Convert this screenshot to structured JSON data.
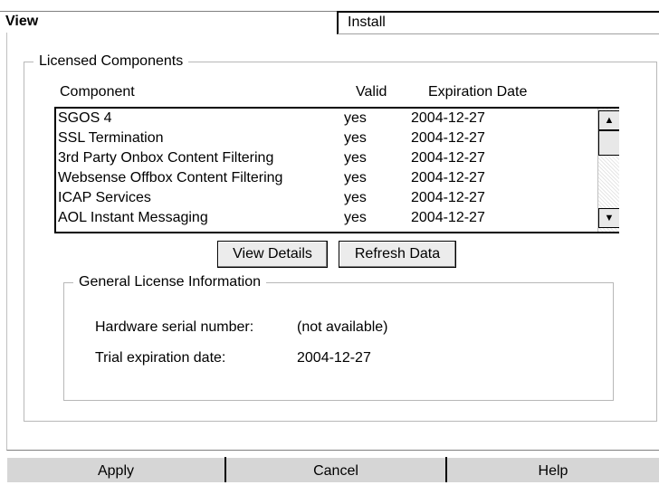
{
  "tabs": {
    "view": "View",
    "install": "Install"
  },
  "licensed_components": {
    "legend": "Licensed Components",
    "headers": {
      "component": "Component",
      "valid": "Valid",
      "expiration": "Expiration Date"
    },
    "rows": [
      {
        "component": "SGOS 4",
        "valid": "yes",
        "expiration": "2004-12-27"
      },
      {
        "component": "SSL Termination",
        "valid": "yes",
        "expiration": "2004-12-27"
      },
      {
        "component": "3rd Party Onbox Content Filtering",
        "valid": "yes",
        "expiration": "2004-12-27"
      },
      {
        "component": "Websense Offbox Content Filtering",
        "valid": "yes",
        "expiration": "2004-12-27"
      },
      {
        "component": "ICAP Services",
        "valid": "yes",
        "expiration": "2004-12-27"
      },
      {
        "component": "AOL Instant Messaging",
        "valid": "yes",
        "expiration": "2004-12-27"
      }
    ],
    "buttons": {
      "view_details": "View Details",
      "refresh_data": "Refresh Data"
    }
  },
  "general_info": {
    "legend": "General License Information",
    "serial_label": "Hardware serial number:",
    "serial_value": "(not available)",
    "trial_label": "Trial expiration date:",
    "trial_value": "2004-12-27"
  },
  "footer": {
    "apply": "Apply",
    "cancel": "Cancel",
    "help": "Help"
  },
  "scrollbar": {
    "up_icon": "arrow-up",
    "down_icon": "arrow-down"
  }
}
